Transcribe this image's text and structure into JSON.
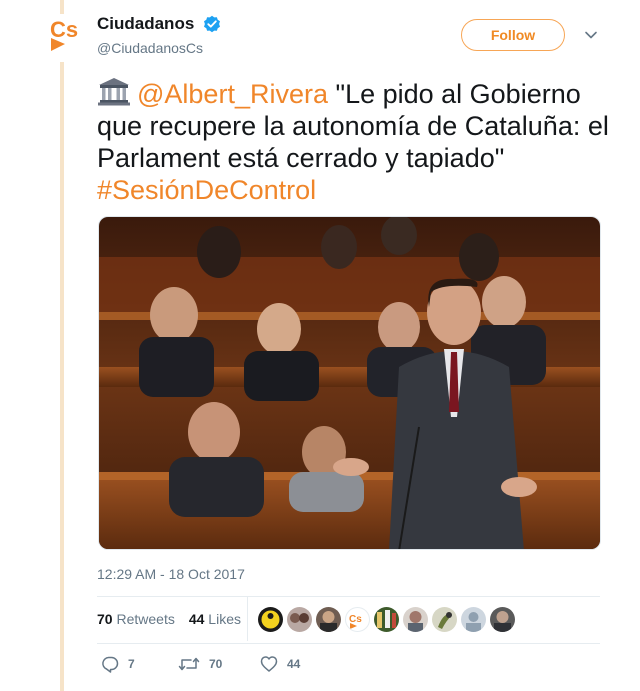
{
  "account": {
    "display_name": "Ciudadanos",
    "handle": "@CiudadanosCs",
    "verified": true,
    "logo_text": "Cs",
    "brand_color": "#f0862a"
  },
  "follow_label": "Follow",
  "tweet": {
    "emoji": "classical-building-icon",
    "mention": "@Albert_Rivera",
    "text": " \"Le pido al Gobierno que recupere la autonomía de Cataluña: el Parlament está cerrado y tapiado\"",
    "hashtag": "#SesiónDeControl",
    "link_color": "#f0862a"
  },
  "timestamp": "12:29 AM - 18 Oct 2017",
  "stats": {
    "retweets_count": "70",
    "retweets_label": "Retweets",
    "likes_count": "44",
    "likes_label": "Likes"
  },
  "liked_by_avatars": [
    "avatar-1",
    "avatar-2",
    "avatar-3",
    "avatar-4",
    "avatar-5",
    "avatar-6",
    "avatar-7",
    "avatar-8",
    "avatar-9"
  ],
  "actions": {
    "reply_count": "7",
    "retweet_count": "70",
    "like_count": "44"
  }
}
